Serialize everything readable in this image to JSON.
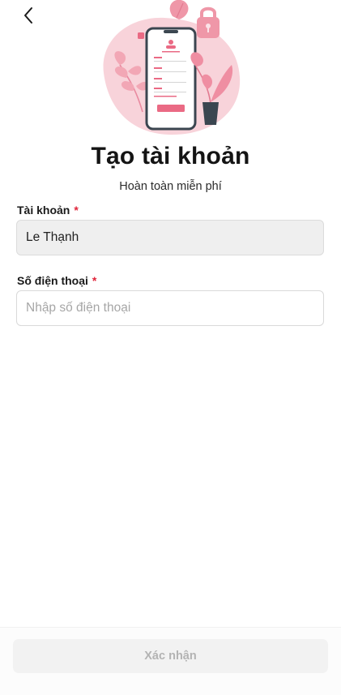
{
  "header": {
    "back_icon": "chevron-left-icon"
  },
  "illustration": {
    "icon": "phone-signup-illustration",
    "colors": {
      "pink": "#f2a7b5",
      "light_pink": "#f8d3da",
      "accent": "#ea6a84",
      "dark": "#3b4650"
    }
  },
  "title": "Tạo tài khoản",
  "subtitle": "Hoàn toàn miễn phí",
  "form": {
    "account": {
      "label": "Tài khoản",
      "required_mark": "*",
      "value": "Le Thạnh"
    },
    "phone": {
      "label": "Số điện thoại",
      "required_mark": "*",
      "value": "",
      "placeholder": "Nhập số điện thoại"
    }
  },
  "footer": {
    "confirm_label": "Xác nhận"
  },
  "colors": {
    "required": "#e0243a",
    "disabled_button_bg": "#f2f2f2",
    "disabled_button_text": "#b3b3b3"
  }
}
